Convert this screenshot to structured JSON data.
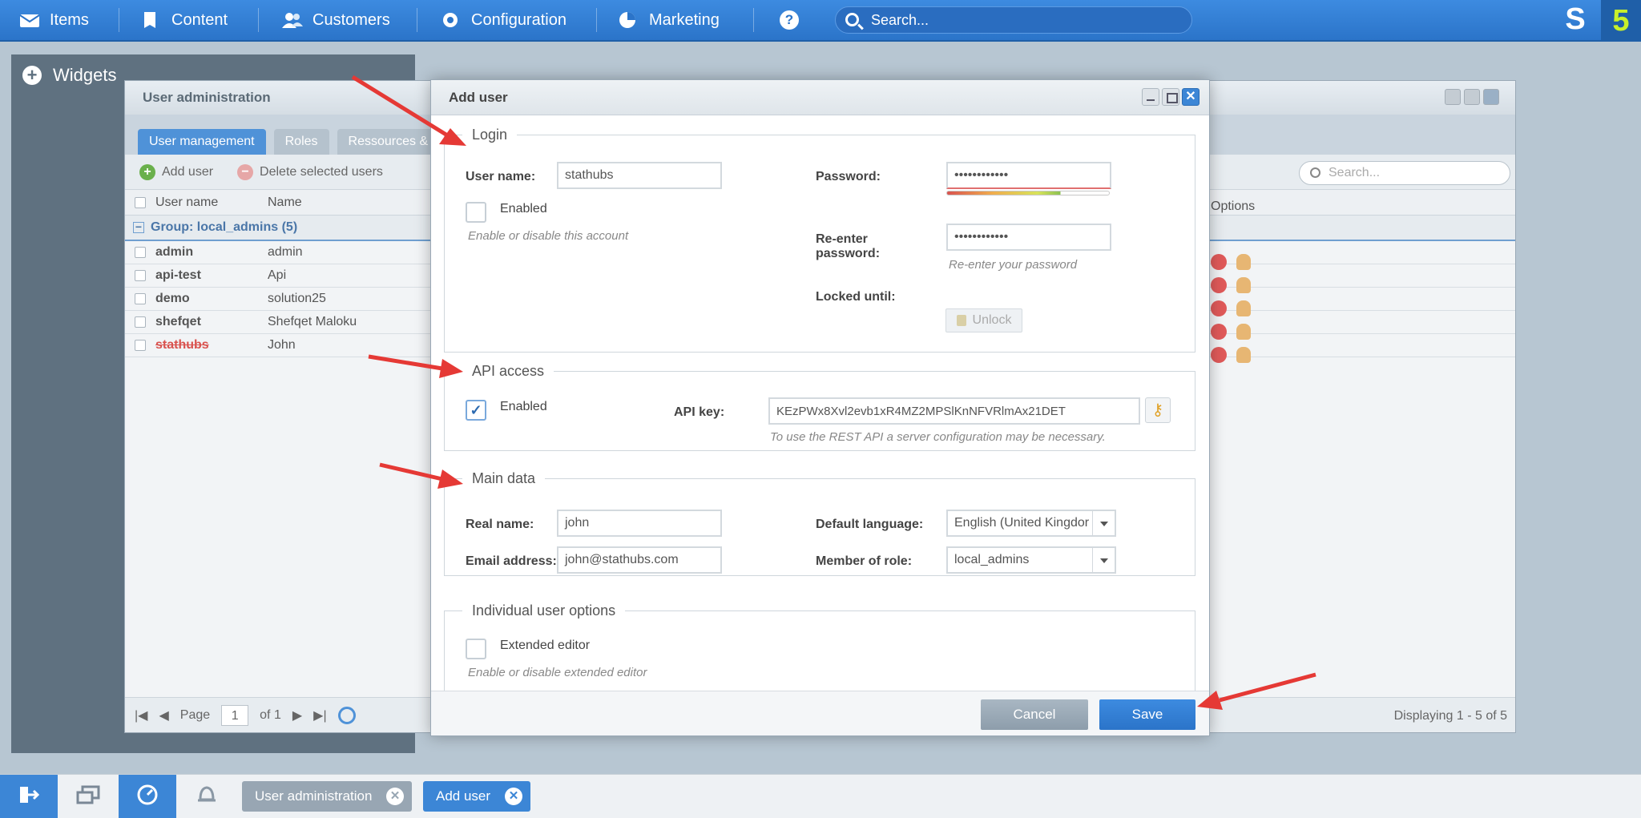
{
  "topnav": {
    "items": [
      {
        "label": "Items",
        "icon": "mail-icon"
      },
      {
        "label": "Content",
        "icon": "document-icon"
      },
      {
        "label": "Customers",
        "icon": "people-icon"
      },
      {
        "label": "Configuration",
        "icon": "gear-icon"
      },
      {
        "label": "Marketing",
        "icon": "pie-chart-icon"
      }
    ],
    "help": "?",
    "search_placeholder": "Search...",
    "logo_mark": "S",
    "logo_number": "5"
  },
  "widgets": {
    "title": "Widgets"
  },
  "user_admin": {
    "title": "User administration",
    "tabs": [
      "User management",
      "Roles",
      "Ressources & p"
    ],
    "toolbar": {
      "add": "Add user",
      "delete": "Delete selected users"
    },
    "columns": {
      "username": "User name",
      "name": "Name",
      "options": "Options"
    },
    "search_placeholder": "Search...",
    "group": "Group: local_admins (5)",
    "rows": [
      {
        "username": "admin",
        "name": "admin"
      },
      {
        "username": "api-test",
        "name": "Api"
      },
      {
        "username": "demo",
        "name": "solution25"
      },
      {
        "username": "shefqet",
        "name": "Shefqet Maloku"
      },
      {
        "username": "stathubs",
        "name": "John"
      }
    ],
    "pager": {
      "page_label": "Page",
      "page": "1",
      "of": "of 1",
      "displaying": "Displaying 1 - 5 of 5"
    }
  },
  "dialog": {
    "title": "Add user",
    "login": {
      "legend": "Login",
      "username_label": "User name:",
      "username": "stathubs",
      "enabled_label": "Enabled",
      "enabled_hint": "Enable or disable this account",
      "password_label": "Password:",
      "password": "••••••••••••",
      "password_strength": 0.7,
      "reenter_label_1": "Re-enter",
      "reenter_label_2": "password:",
      "reenter": "••••••••••••",
      "reenter_hint": "Re-enter your password",
      "locked_label": "Locked until:",
      "unlock_label": "Unlock"
    },
    "api": {
      "legend": "API access",
      "enabled_label": "Enabled",
      "enabled_checked": "✓",
      "key_label": "API key:",
      "key": "KEzPWx8Xvl2evb1xR4MZ2MPSlKnNFVRlmAx21DET",
      "hint": "To use the REST API a server configuration may be necessary."
    },
    "main": {
      "legend": "Main data",
      "realname_label": "Real name:",
      "realname": "john",
      "email_label": "Email address:",
      "email": "john@stathubs.com",
      "language_label": "Default language:",
      "language": "English (United Kingdor",
      "role_label": "Member of role:",
      "role": "local_admins"
    },
    "options": {
      "legend": "Individual user options",
      "extended_label": "Extended editor",
      "extended_hint": "Enable or disable extended editor"
    },
    "cancel": "Cancel",
    "save": "Save"
  },
  "taskbar": {
    "tabs": [
      {
        "label": "User administration"
      },
      {
        "label": "Add user"
      }
    ],
    "close": "✕"
  },
  "colors": {
    "accent": "#3c86d6",
    "arrow": "#e53935",
    "danger": "#d9534f"
  }
}
